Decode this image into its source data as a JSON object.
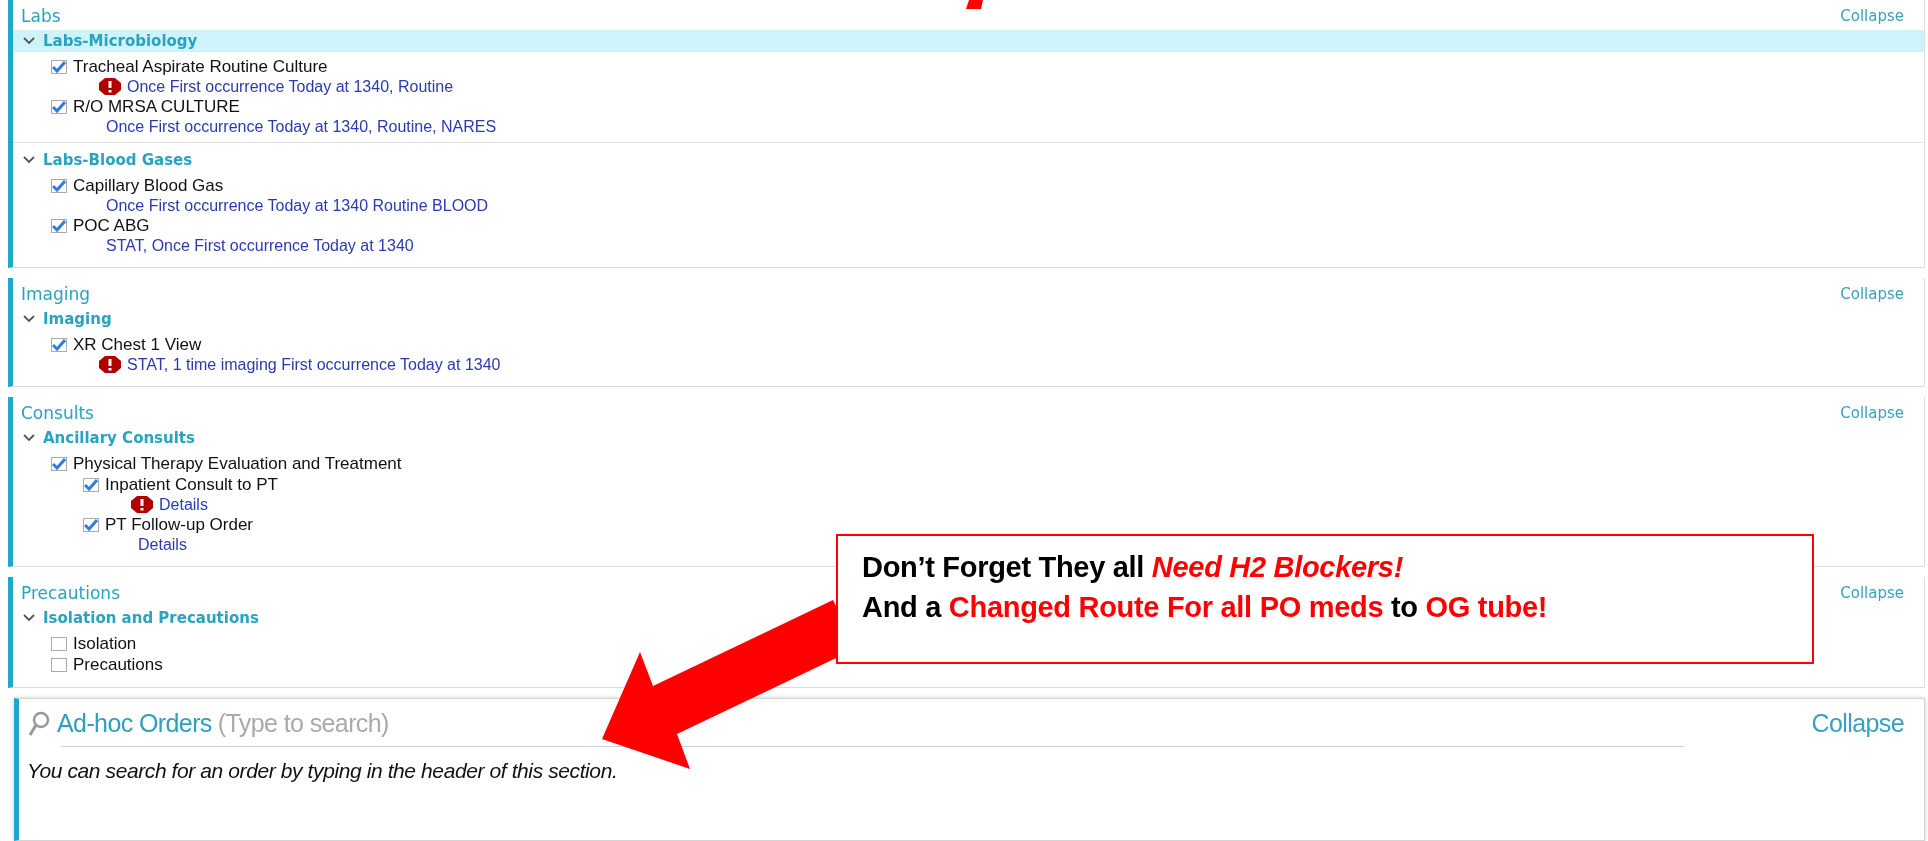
{
  "sections": [
    {
      "title": "Labs",
      "collapse": "Collapse",
      "groups": [
        {
          "title": "Labs-Microbiology",
          "selected": true,
          "expanded": true,
          "orders": [
            {
              "label": "Tracheal Aspirate Routine Culture",
              "checked": true,
              "alert": true,
              "detail": "Once First occurrence Today at 1340, Routine"
            },
            {
              "label": "R/O MRSA CULTURE",
              "checked": true,
              "alert": false,
              "detail": "Once First occurrence Today at 1340, Routine, NARES"
            }
          ]
        },
        {
          "title": "Labs-Blood Gases",
          "selected": false,
          "expanded": true,
          "orders": [
            {
              "label": "Capillary Blood Gas",
              "checked": true,
              "alert": false,
              "detail": "Once First occurrence Today at 1340 Routine BLOOD"
            },
            {
              "label": "POC ABG",
              "checked": true,
              "alert": false,
              "detail": "STAT, Once First occurrence Today at 1340"
            }
          ]
        }
      ]
    },
    {
      "title": "Imaging",
      "collapse": "Collapse",
      "groups": [
        {
          "title": "Imaging",
          "selected": false,
          "expanded": true,
          "orders": [
            {
              "label": "XR Chest 1 View",
              "checked": true,
              "alert": true,
              "detail": "STAT, 1 time imaging First occurrence Today at 1340"
            }
          ]
        }
      ]
    },
    {
      "title": "Consults",
      "collapse": "Collapse",
      "groups": [
        {
          "title": "Ancillary Consults",
          "selected": false,
          "expanded": true,
          "orders": [
            {
              "label": "Physical Therapy Evaluation and Treatment",
              "checked": true,
              "children": [
                {
                  "label": "Inpatient Consult to PT",
                  "checked": true,
                  "alert": true,
                  "detail": "Details"
                },
                {
                  "label": "PT Follow-up Order",
                  "checked": true,
                  "alert": false,
                  "detail": "Details"
                }
              ]
            }
          ]
        }
      ]
    },
    {
      "title": "Precautions",
      "collapse": "Collapse",
      "groups": [
        {
          "title": "Isolation and Precautions",
          "selected": false,
          "expanded": true,
          "orders": [
            {
              "label": "Isolation",
              "checked": false
            },
            {
              "label": "Precautions",
              "checked": false
            }
          ]
        }
      ]
    }
  ],
  "adhoc": {
    "title": "Ad-hoc Orders",
    "placeholder": "(Type to search)",
    "collapse": "Collapse",
    "hint": "You can search for an order by typing in the header of this section."
  },
  "callout": {
    "lines": [
      [
        {
          "text": "Don’t Forget They all ",
          "kind": "plain"
        },
        {
          "text": "Need H2 Blockers!",
          "kind": "red-italic"
        }
      ],
      [
        {
          "text": "And a ",
          "kind": "plain"
        },
        {
          "text": "Changed Route For all PO meds",
          "kind": "red"
        },
        {
          "text": " to ",
          "kind": "plain"
        },
        {
          "text": "OG tube!",
          "kind": "red"
        }
      ]
    ]
  }
}
